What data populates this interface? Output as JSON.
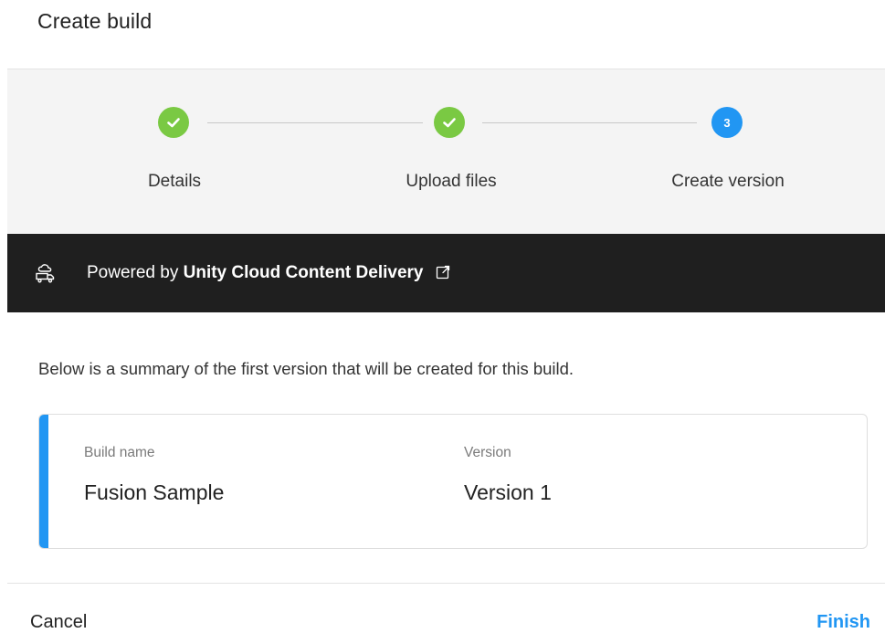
{
  "dialog": {
    "title": "Create build"
  },
  "stepper": {
    "steps": [
      {
        "label": "Details",
        "state": "completed",
        "icon": "check-icon"
      },
      {
        "label": "Upload files",
        "state": "completed",
        "icon": "check-icon"
      },
      {
        "label": "Create version",
        "state": "active",
        "number": "3"
      }
    ],
    "colors": {
      "completed": "#7ac943",
      "active": "#2196f3"
    }
  },
  "banner": {
    "icon": "cloud-delivery-icon",
    "prefix": "Powered by",
    "link_label": "Unity Cloud Content Delivery",
    "link_icon": "external-link-icon"
  },
  "summary": {
    "intro": "Below is a summary of the first version that will be created for this build.",
    "fields": [
      {
        "label": "Build name",
        "value": "Fusion Sample"
      },
      {
        "label": "Version",
        "value": "Version 1"
      }
    ],
    "accent_color": "#2196f3"
  },
  "footer": {
    "cancel_label": "Cancel",
    "finish_label": "Finish"
  }
}
